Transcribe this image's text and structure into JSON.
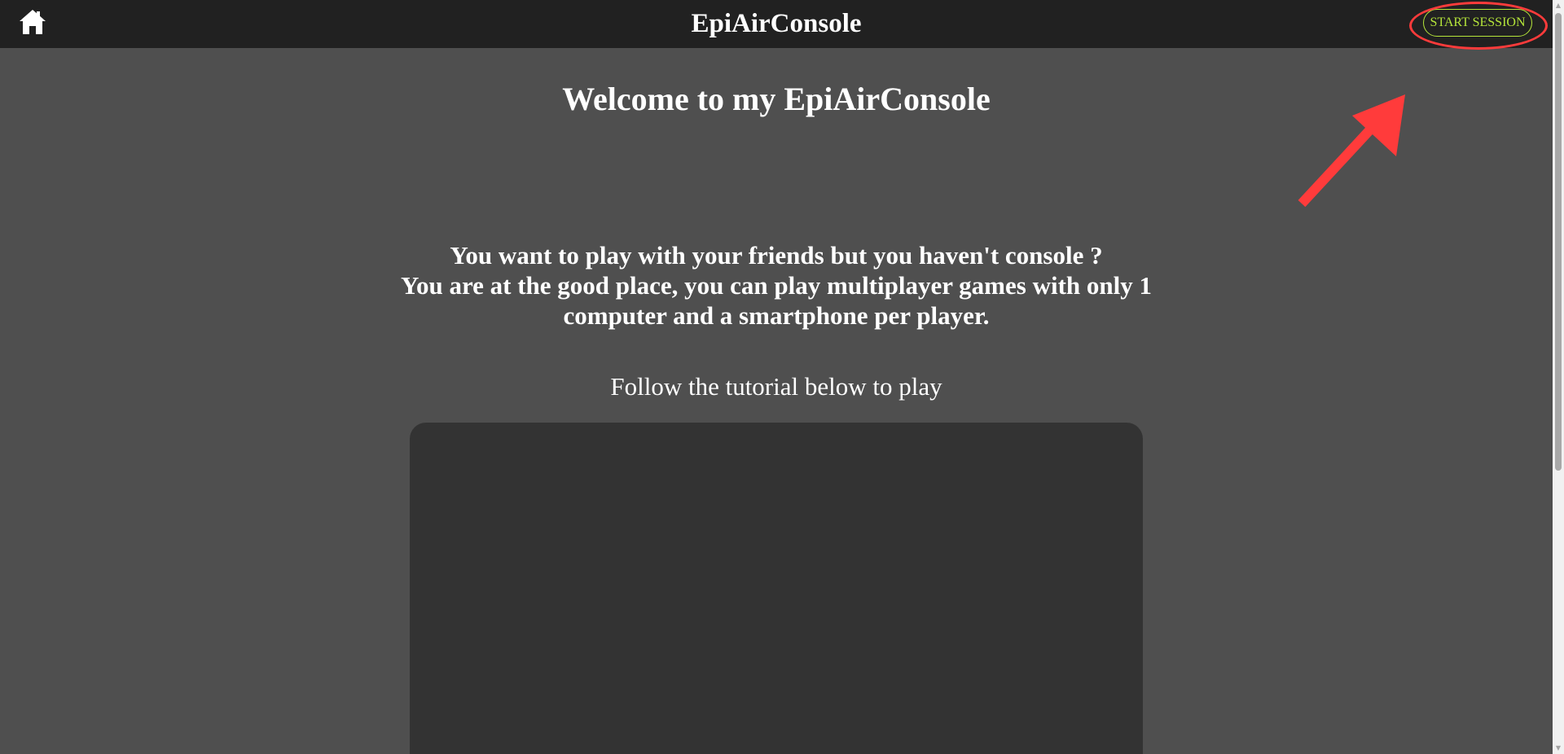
{
  "navbar": {
    "title": "EpiAirConsole",
    "home_icon": "home-icon",
    "start_session_label": "START SESSION",
    "accent_color": "#b5e53a"
  },
  "main": {
    "welcome_heading": "Welcome to my EpiAirConsole",
    "intro_lines": [
      "You want to play with your friends but you haven't console ?",
      "You are at the good place, you can play multiplayer games with only 1 computer and a smartphone per player."
    ],
    "tutorial_caption": "Follow the tutorial below to play"
  },
  "annotation": {
    "color": "#ff3b3b",
    "arrow_icon": "arrow-icon"
  },
  "colors": {
    "background": "#4f4f4f",
    "navbar": "#212121",
    "video_frame": "#333333"
  }
}
